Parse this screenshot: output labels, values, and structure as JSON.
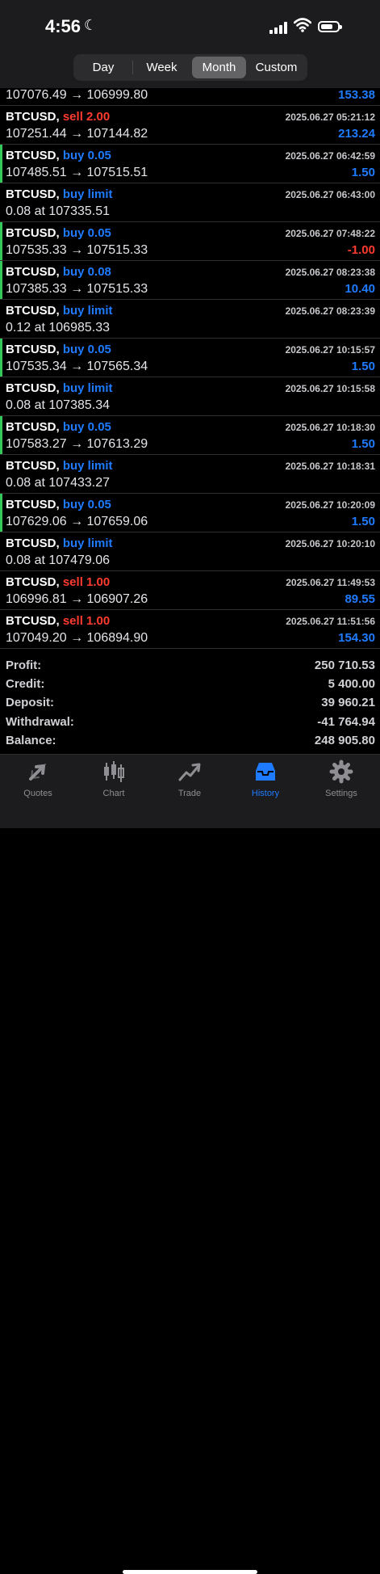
{
  "status": {
    "time": "4:56",
    "moon": "☾"
  },
  "period_selector": [
    "Day",
    "Week",
    "Month",
    "Custom"
  ],
  "selected_period": "Month",
  "trades": [
    {
      "symbol": "",
      "type": "",
      "type_class": "",
      "date": "",
      "line2": "107076.49 → 106999.80",
      "amount": "153.38",
      "amount_class": "pos",
      "marked": false
    },
    {
      "symbol": "BTCUSD,",
      "type": "sell 2.00",
      "type_class": "sell",
      "date": "2025.06.27 05:21:12",
      "line2": "107251.44 → 107144.82",
      "amount": "213.24",
      "amount_class": "pos",
      "marked": false
    },
    {
      "symbol": "BTCUSD,",
      "type": "buy 0.05",
      "type_class": "buy",
      "date": "2025.06.27 06:42:59",
      "line2": "107485.51 → 107515.51",
      "amount": "1.50",
      "amount_class": "pos",
      "marked": true
    },
    {
      "symbol": "BTCUSD,",
      "type": "buy limit",
      "type_class": "buy",
      "date": "2025.06.27 06:43:00",
      "line2": "0.08 at 107335.51",
      "amount": "",
      "amount_class": "",
      "marked": false
    },
    {
      "symbol": "BTCUSD,",
      "type": "buy 0.05",
      "type_class": "buy",
      "date": "2025.06.27 07:48:22",
      "line2": "107535.33 → 107515.33",
      "amount": "-1.00",
      "amount_class": "neg",
      "marked": true
    },
    {
      "symbol": "BTCUSD,",
      "type": "buy 0.08",
      "type_class": "buy",
      "date": "2025.06.27 08:23:38",
      "line2": "107385.33 → 107515.33",
      "amount": "10.40",
      "amount_class": "pos",
      "marked": true
    },
    {
      "symbol": "BTCUSD,",
      "type": "buy limit",
      "type_class": "buy",
      "date": "2025.06.27 08:23:39",
      "line2": "0.12 at 106985.33",
      "amount": "",
      "amount_class": "",
      "marked": false
    },
    {
      "symbol": "BTCUSD,",
      "type": "buy 0.05",
      "type_class": "buy",
      "date": "2025.06.27 10:15:57",
      "line2": "107535.34 → 107565.34",
      "amount": "1.50",
      "amount_class": "pos",
      "marked": true
    },
    {
      "symbol": "BTCUSD,",
      "type": "buy limit",
      "type_class": "buy",
      "date": "2025.06.27 10:15:58",
      "line2": "0.08 at 107385.34",
      "amount": "",
      "amount_class": "",
      "marked": false
    },
    {
      "symbol": "BTCUSD,",
      "type": "buy 0.05",
      "type_class": "buy",
      "date": "2025.06.27 10:18:30",
      "line2": "107583.27 → 107613.29",
      "amount": "1.50",
      "amount_class": "pos",
      "marked": true
    },
    {
      "symbol": "BTCUSD,",
      "type": "buy limit",
      "type_class": "buy",
      "date": "2025.06.27 10:18:31",
      "line2": "0.08 at 107433.27",
      "amount": "",
      "amount_class": "",
      "marked": false
    },
    {
      "symbol": "BTCUSD,",
      "type": "buy 0.05",
      "type_class": "buy",
      "date": "2025.06.27 10:20:09",
      "line2": "107629.06 → 107659.06",
      "amount": "1.50",
      "amount_class": "pos",
      "marked": true
    },
    {
      "symbol": "BTCUSD,",
      "type": "buy limit",
      "type_class": "buy",
      "date": "2025.06.27 10:20:10",
      "line2": "0.08 at 107479.06",
      "amount": "",
      "amount_class": "",
      "marked": false
    },
    {
      "symbol": "BTCUSD,",
      "type": "sell 1.00",
      "type_class": "sell",
      "date": "2025.06.27 11:49:53",
      "line2": "106996.81 → 106907.26",
      "amount": "89.55",
      "amount_class": "pos",
      "marked": false
    },
    {
      "symbol": "BTCUSD,",
      "type": "sell 1.00",
      "type_class": "sell",
      "date": "2025.06.27 11:51:56",
      "line2": "107049.20 → 106894.90",
      "amount": "154.30",
      "amount_class": "pos",
      "marked": false
    }
  ],
  "summary": [
    {
      "label": "Profit:",
      "value": "250 710.53"
    },
    {
      "label": "Credit:",
      "value": "5 400.00"
    },
    {
      "label": "Deposit:",
      "value": "39 960.21"
    },
    {
      "label": "Withdrawal:",
      "value": "-41 764.94"
    },
    {
      "label": "Balance:",
      "value": "248 905.80"
    }
  ],
  "tabs": [
    {
      "label": "Quotes",
      "icon": "quotes-arrows-icon"
    },
    {
      "label": "Chart",
      "icon": "candlestick-icon"
    },
    {
      "label": "Trade",
      "icon": "trend-line-icon"
    },
    {
      "label": "History",
      "icon": "inbox-tray-icon"
    },
    {
      "label": "Settings",
      "icon": "gear-icon"
    }
  ],
  "active_tab": "History",
  "colors": {
    "buy": "#1e7bff",
    "sell": "#ff3b30",
    "marker": "#34c759",
    "background": "#000000"
  }
}
